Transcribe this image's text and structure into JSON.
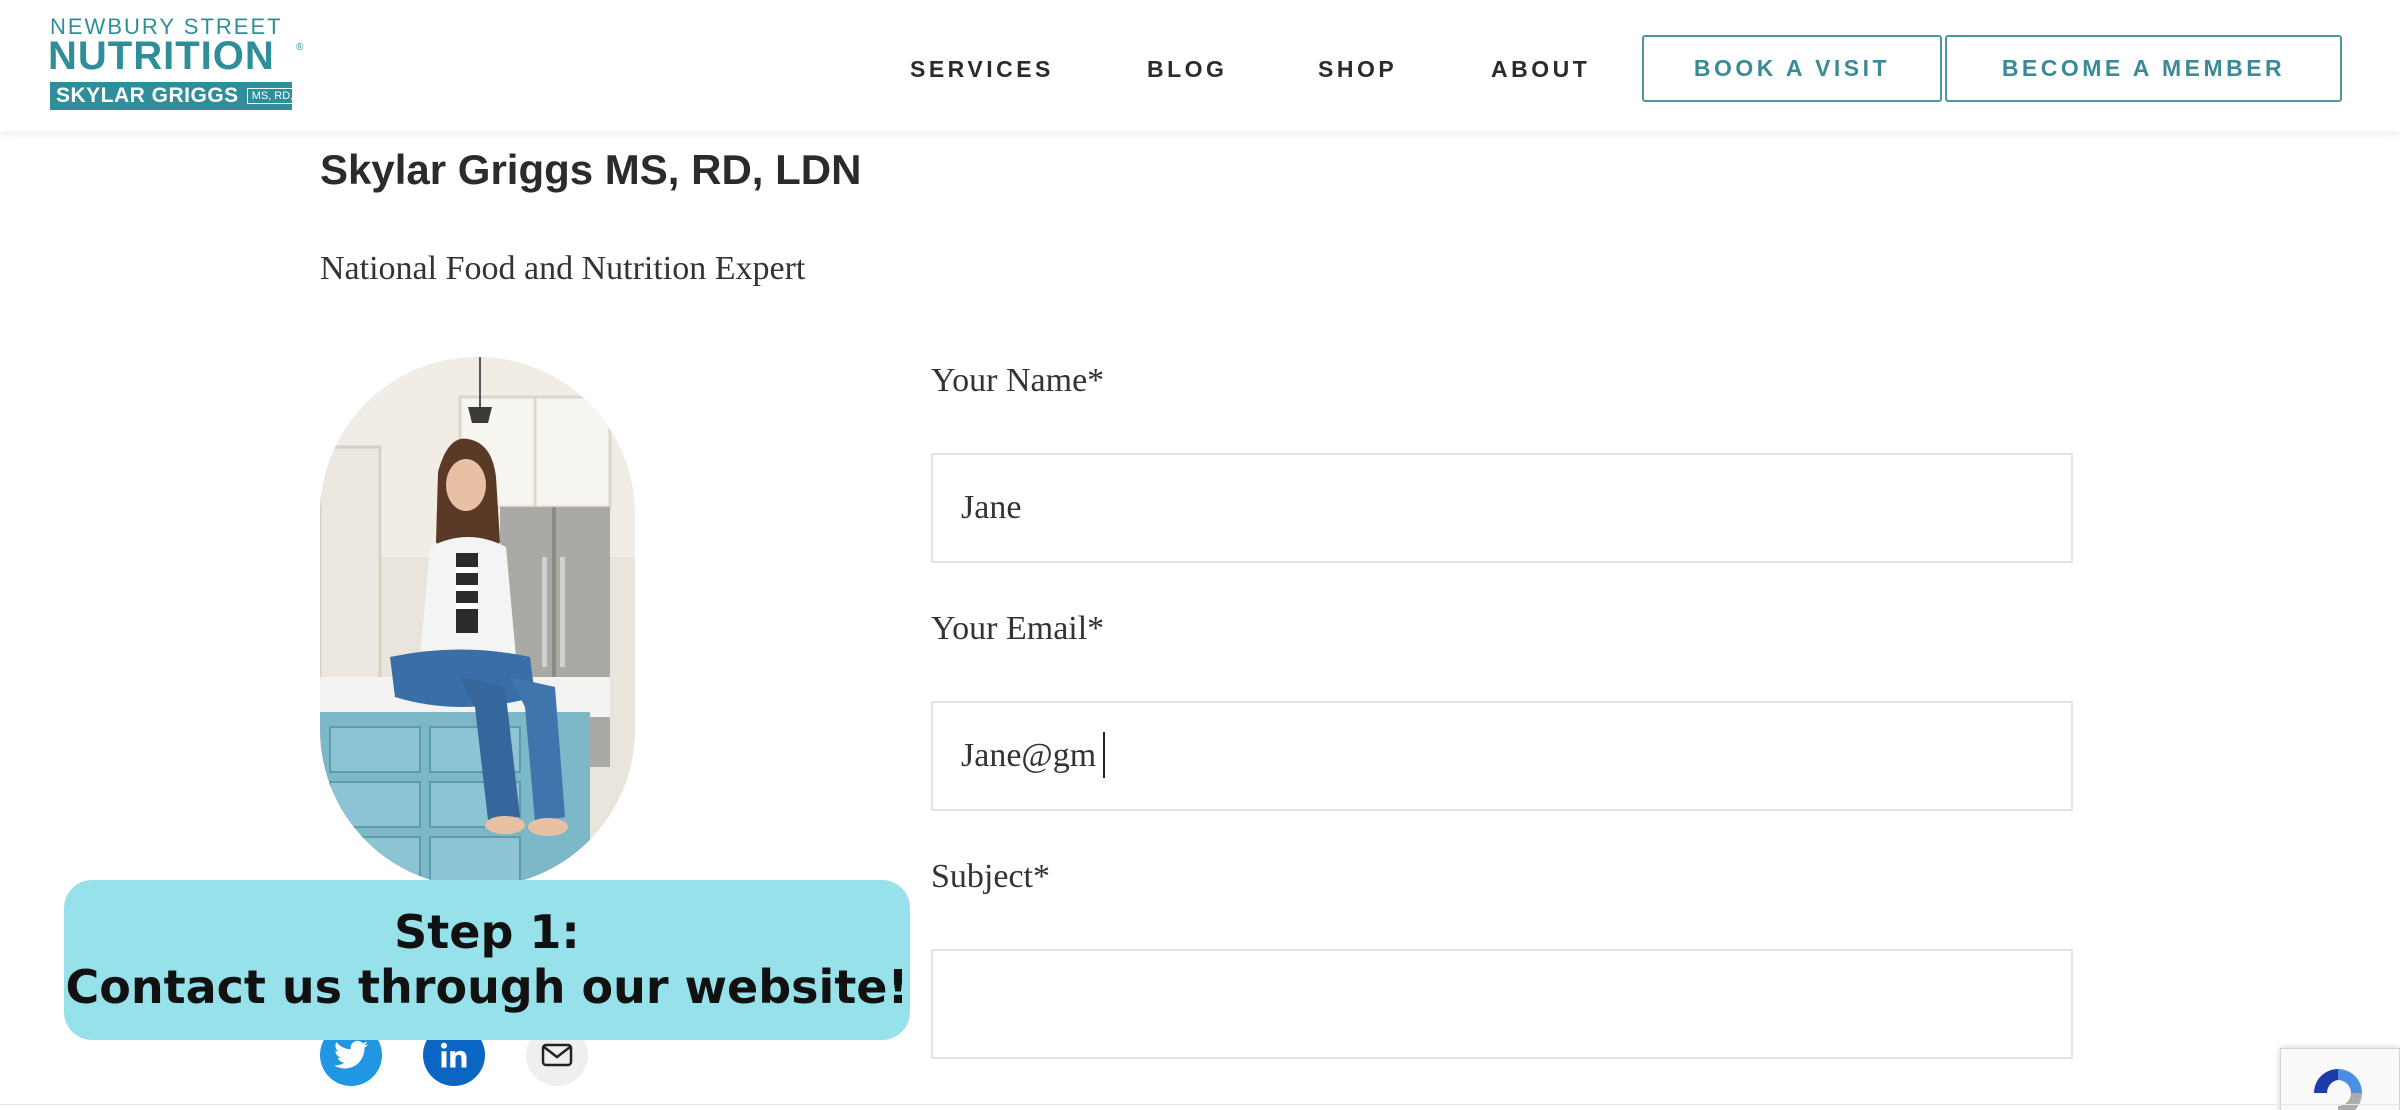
{
  "header": {
    "logo": {
      "line1": "NEWBURY STREET",
      "line2": "NUTRITION",
      "registered": "®",
      "name": "SKYLAR GRIGGS",
      "credentials": "MS, RD, LDN"
    },
    "nav": {
      "services": "SERVICES",
      "blog": "BLOG",
      "shop": "SHOP",
      "about": "ABOUT"
    },
    "buttons": {
      "book": "BOOK A VISIT",
      "member": "BECOME A MEMBER"
    }
  },
  "profile": {
    "name": "Skylar Griggs MS, RD, LDN",
    "title": "National Food and Nutrition Expert",
    "photo_icon": "portrait-photo"
  },
  "form": {
    "name_label": "Your Name*",
    "name_value": "Jane",
    "email_label": "Your Email*",
    "email_value": "Jane@gm",
    "subject_label": "Subject*",
    "subject_value": ""
  },
  "social": {
    "icons": [
      "twitter-icon",
      "linkedin-icon",
      "mail-icon"
    ]
  },
  "banner": {
    "line1": "Step 1:",
    "line2": "Contact us through our website!"
  },
  "colors": {
    "brand": "#2f8e9a",
    "button_border": "#4c98a0",
    "banner_bg": "#97e2ea",
    "twitter": "#2196e3",
    "linkedin": "#0a66c2"
  }
}
